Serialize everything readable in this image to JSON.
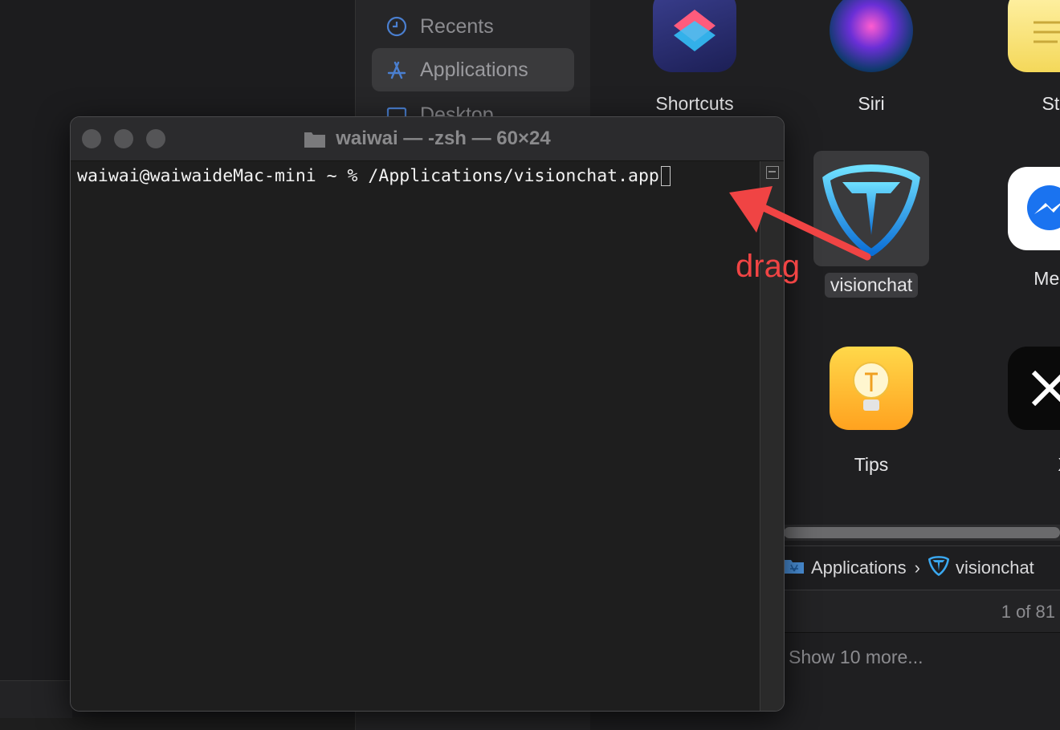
{
  "finder": {
    "sidebar": {
      "items": [
        {
          "label": "Recents",
          "icon": "clock-icon"
        },
        {
          "label": "Applications",
          "icon": "applications-icon",
          "selected": true
        },
        {
          "label": "Desktop",
          "icon": "desktop-icon"
        }
      ]
    },
    "apps": [
      {
        "label": "Shortcuts",
        "icon": "shortcuts-icon"
      },
      {
        "label": "Siri",
        "icon": "siri-icon"
      },
      {
        "label": "Sticki",
        "icon": "stickies-icon"
      },
      {
        "label": "visionchat",
        "icon": "visionchat-icon",
        "selected": true
      },
      {
        "label": "Messer",
        "icon": "messenger-icon"
      },
      {
        "label": "Tips",
        "icon": "tips-icon"
      },
      {
        "label": "X",
        "icon": "x-icon"
      }
    ],
    "pathbar": {
      "folder": "Applications",
      "separator": "›",
      "item": "visionchat"
    },
    "status": "1 of 81",
    "show_more": "Show 10 more..."
  },
  "terminal": {
    "title": "waiwai — -zsh — 60×24",
    "prompt_line": "waiwai@waiwaideMac-mini ~ % /Applications/visionchat.app"
  },
  "annotation": {
    "label": "drag",
    "color": "#f04444"
  }
}
